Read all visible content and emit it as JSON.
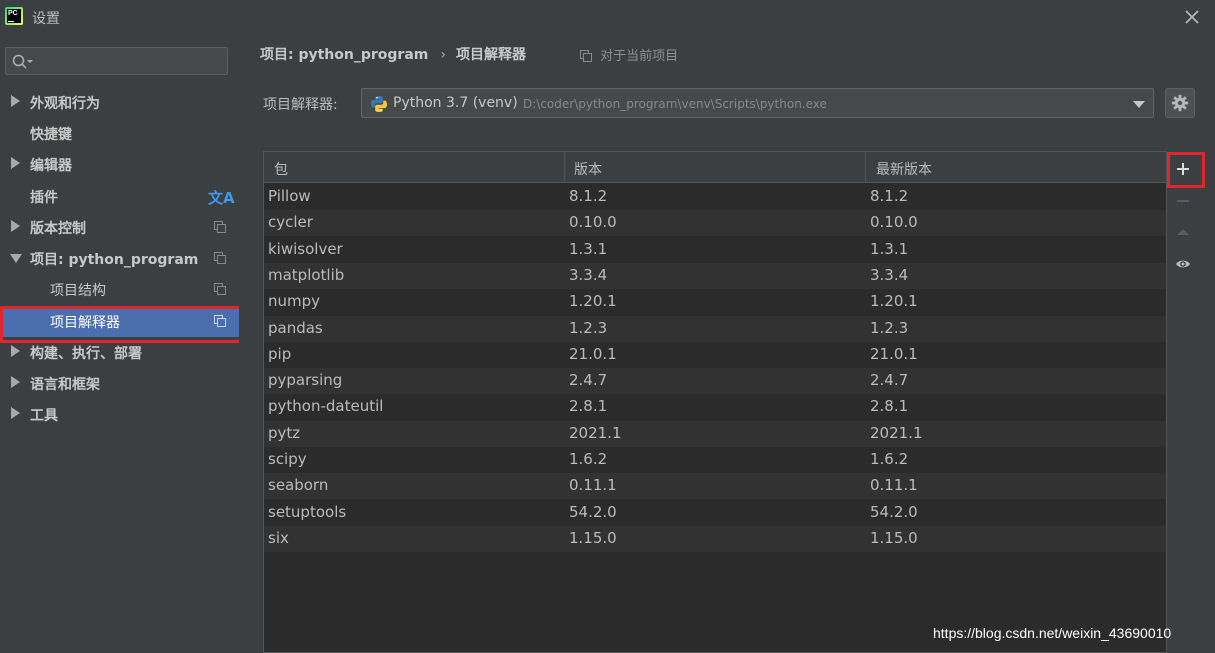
{
  "window": {
    "app_icon_text": "PC",
    "title": "设置"
  },
  "sidebar": {
    "search": {
      "value": "",
      "placeholder": ""
    },
    "items": [
      {
        "label": "外观和行为",
        "expandable": true,
        "expanded": false
      },
      {
        "label": "快捷键",
        "expandable": false
      },
      {
        "label": "编辑器",
        "expandable": true,
        "expanded": false
      },
      {
        "label": "插件",
        "expandable": false,
        "icon": "translate-icon"
      },
      {
        "label": "版本控制",
        "expandable": true,
        "expanded": false,
        "icon": "copy-icon"
      },
      {
        "label": "项目: python_program",
        "expandable": true,
        "expanded": true,
        "icon": "copy-icon"
      },
      {
        "label": "项目结构",
        "sub": true,
        "icon": "copy-icon"
      },
      {
        "label": "项目解释器",
        "sub": true,
        "selected": true,
        "icon": "copy-icon"
      },
      {
        "label": "构建、执行、部署",
        "expandable": true,
        "expanded": false
      },
      {
        "label": "语言和框架",
        "expandable": true,
        "expanded": false
      },
      {
        "label": "工具",
        "expandable": true,
        "expanded": false
      }
    ],
    "translate_glyph": "文A"
  },
  "main": {
    "breadcrumb": {
      "parent": "项目: python_program",
      "separator": "›",
      "current": "项目解释器"
    },
    "scope_note": "对于当前项目",
    "interpreter": {
      "label": "项目解释器:",
      "name": "Python 3.7 (venv)",
      "path": "D:\\coder\\python_program\\venv\\Scripts\\python.exe"
    },
    "table": {
      "columns": [
        "包",
        "版本",
        "最新版本"
      ],
      "rows": [
        [
          "Pillow",
          "8.1.2",
          "8.1.2"
        ],
        [
          "cycler",
          "0.10.0",
          "0.10.0"
        ],
        [
          "kiwisolver",
          "1.3.1",
          "1.3.1"
        ],
        [
          "matplotlib",
          "3.3.4",
          "3.3.4"
        ],
        [
          "numpy",
          "1.20.1",
          "1.20.1"
        ],
        [
          "pandas",
          "1.2.3",
          "1.2.3"
        ],
        [
          "pip",
          "21.0.1",
          "21.0.1"
        ],
        [
          "pyparsing",
          "2.4.7",
          "2.4.7"
        ],
        [
          "python-dateutil",
          "2.8.1",
          "2.8.1"
        ],
        [
          "pytz",
          "2021.1",
          "2021.1"
        ],
        [
          "scipy",
          "1.6.2",
          "1.6.2"
        ],
        [
          "seaborn",
          "0.11.1",
          "0.11.1"
        ],
        [
          "setuptools",
          "54.2.0",
          "54.2.0"
        ],
        [
          "six",
          "1.15.0",
          "1.15.0"
        ]
      ]
    },
    "toolbar": [
      "add-icon",
      "remove-icon",
      "upgrade-icon",
      "show-early-releases-icon"
    ]
  },
  "colors": {
    "background": "#3c3f41",
    "table_bg": "#2b2b2b",
    "selection": "#4b6eaf",
    "annotation_red": "#e0262d"
  },
  "watermark": "https://blog.csdn.net/weixin_43690010"
}
